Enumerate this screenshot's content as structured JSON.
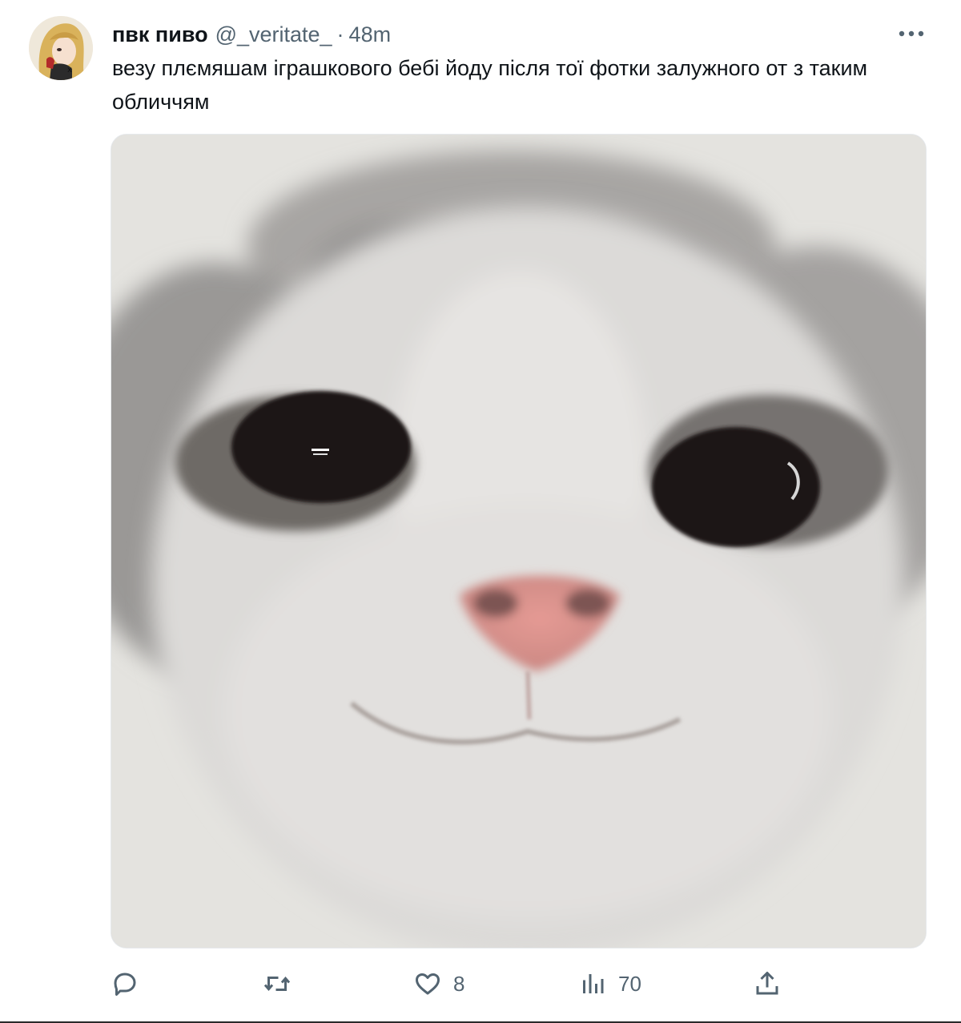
{
  "tweet": {
    "display_name": "пвк пиво",
    "handle": "@_veritate_",
    "separator": "·",
    "time": "48m",
    "text": "везу плємяшам іграшкового бебі йоду після тої фотки залужного от з таким обличчям"
  },
  "actions": {
    "reply": {
      "icon": "reply-icon",
      "count": ""
    },
    "retweet": {
      "icon": "retweet-icon",
      "count": ""
    },
    "like": {
      "icon": "heart-icon",
      "count": "8"
    },
    "views": {
      "icon": "analytics-icon",
      "count": "70"
    },
    "share": {
      "icon": "share-icon"
    }
  },
  "colors": {
    "text_primary": "#0f1419",
    "text_secondary": "#536471",
    "border": "#e6e9ec"
  }
}
